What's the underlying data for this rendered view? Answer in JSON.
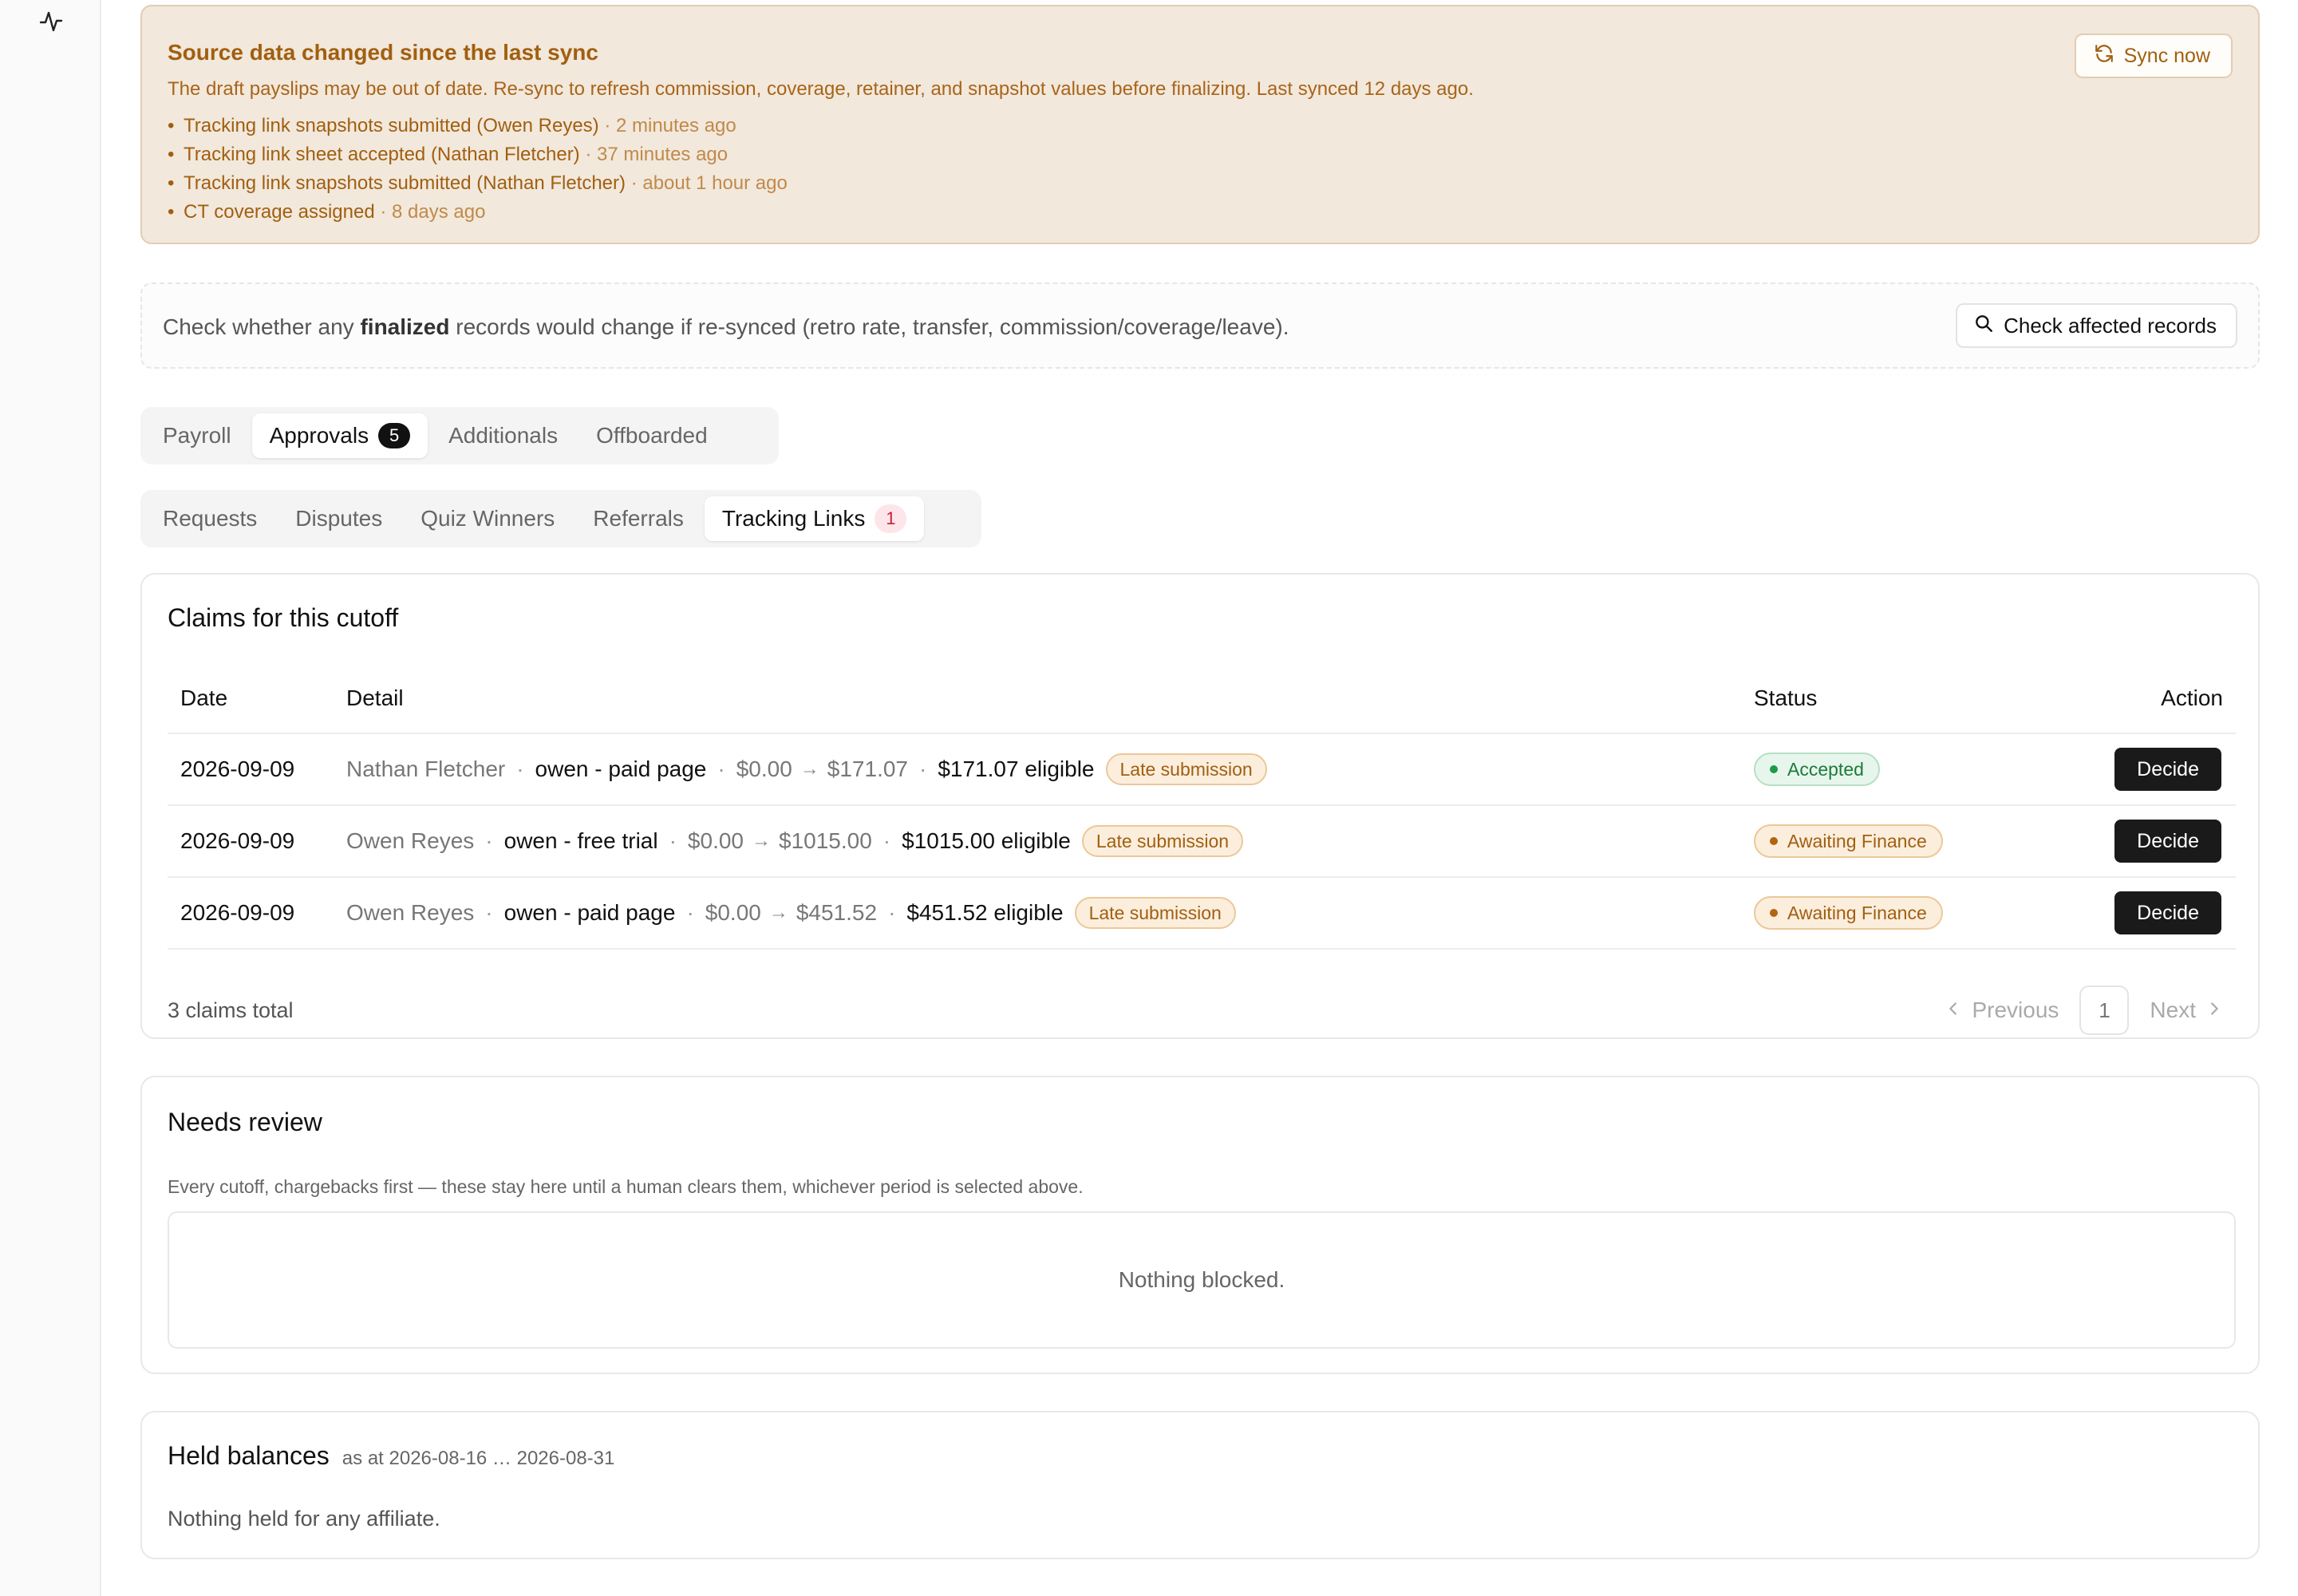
{
  "icons": {
    "activity": "activity-icon",
    "sync": "refresh-icon",
    "search": "search-icon",
    "prev": "chevron-left-icon",
    "next": "chevron-right-icon"
  },
  "colors": {
    "banner_bg": "#f2e8dc",
    "banner_text": "#a15f10",
    "accepted": "#1d7a3c",
    "awaiting": "#a15f10",
    "decide_bg": "#1a1a1a",
    "tab_count_red": "#c81e3a"
  },
  "banner": {
    "title": "Source data changed since the last sync",
    "description": "The draft payslips may be out of date. Re-sync to refresh commission, coverage, retainer, and snapshot values before finalizing. Last synced 12 days ago.",
    "sync_label": "Sync now",
    "changes": [
      {
        "text": "Tracking link snapshots submitted (Owen Reyes)",
        "ago": "· 2 minutes ago"
      },
      {
        "text": "Tracking link sheet accepted (Nathan Fletcher)",
        "ago": "· 37 minutes ago"
      },
      {
        "text": "Tracking link snapshots submitted (Nathan Fletcher)",
        "ago": "· about 1 hour ago"
      },
      {
        "text": "CT coverage assigned",
        "ago": "· 8 days ago"
      }
    ]
  },
  "check": {
    "text_before": "Check whether any ",
    "text_bold": "finalized",
    "text_after": " records would change if re-synced (retro rate, transfer, commission/coverage/leave).",
    "button_label": "Check affected records"
  },
  "primary_tabs": [
    {
      "label": "Payroll"
    },
    {
      "label": "Approvals",
      "count": "5"
    },
    {
      "label": "Additionals"
    },
    {
      "label": "Offboarded"
    }
  ],
  "secondary_tabs": [
    {
      "label": "Requests"
    },
    {
      "label": "Disputes"
    },
    {
      "label": "Quiz Winners"
    },
    {
      "label": "Referrals"
    },
    {
      "label": "Tracking Links",
      "count": "1"
    }
  ],
  "claims": {
    "title": "Claims for this cutoff",
    "columns": {
      "date": "Date",
      "detail": "Detail",
      "status": "Status",
      "action": "Action"
    },
    "rows": [
      {
        "date": "2026-09-09",
        "person": "Nathan Fletcher",
        "item": "owen - paid page",
        "from": "$0.00",
        "arrow": "→",
        "to": "$171.07",
        "eligible": "$171.07 eligible",
        "badge": "Late submission",
        "status": "Accepted",
        "action": "Decide"
      },
      {
        "date": "2026-09-09",
        "person": "Owen Reyes",
        "item": "owen - free trial",
        "from": "$0.00",
        "arrow": "→",
        "to": "$1015.00",
        "eligible": "$1015.00 eligible",
        "badge": "Late submission",
        "status": "Awaiting Finance",
        "action": "Decide"
      },
      {
        "date": "2026-09-09",
        "person": "Owen Reyes",
        "item": "owen - paid page",
        "from": "$0.00",
        "arrow": "→",
        "to": "$451.52",
        "eligible": "$451.52 eligible",
        "badge": "Late submission",
        "status": "Awaiting Finance",
        "action": "Decide"
      }
    ],
    "separator": "·",
    "total": "3 claims total",
    "pagination": {
      "previous": "Previous",
      "page": "1",
      "next": "Next"
    }
  },
  "review": {
    "title": "Needs review",
    "description": "Every cutoff, chargebacks first — these stay here until a human clears them, whichever period is selected above.",
    "empty": "Nothing blocked."
  },
  "held": {
    "title": "Held balances",
    "period": "as at 2026-08-16 … 2026-08-31",
    "empty": "Nothing held for any affiliate."
  }
}
